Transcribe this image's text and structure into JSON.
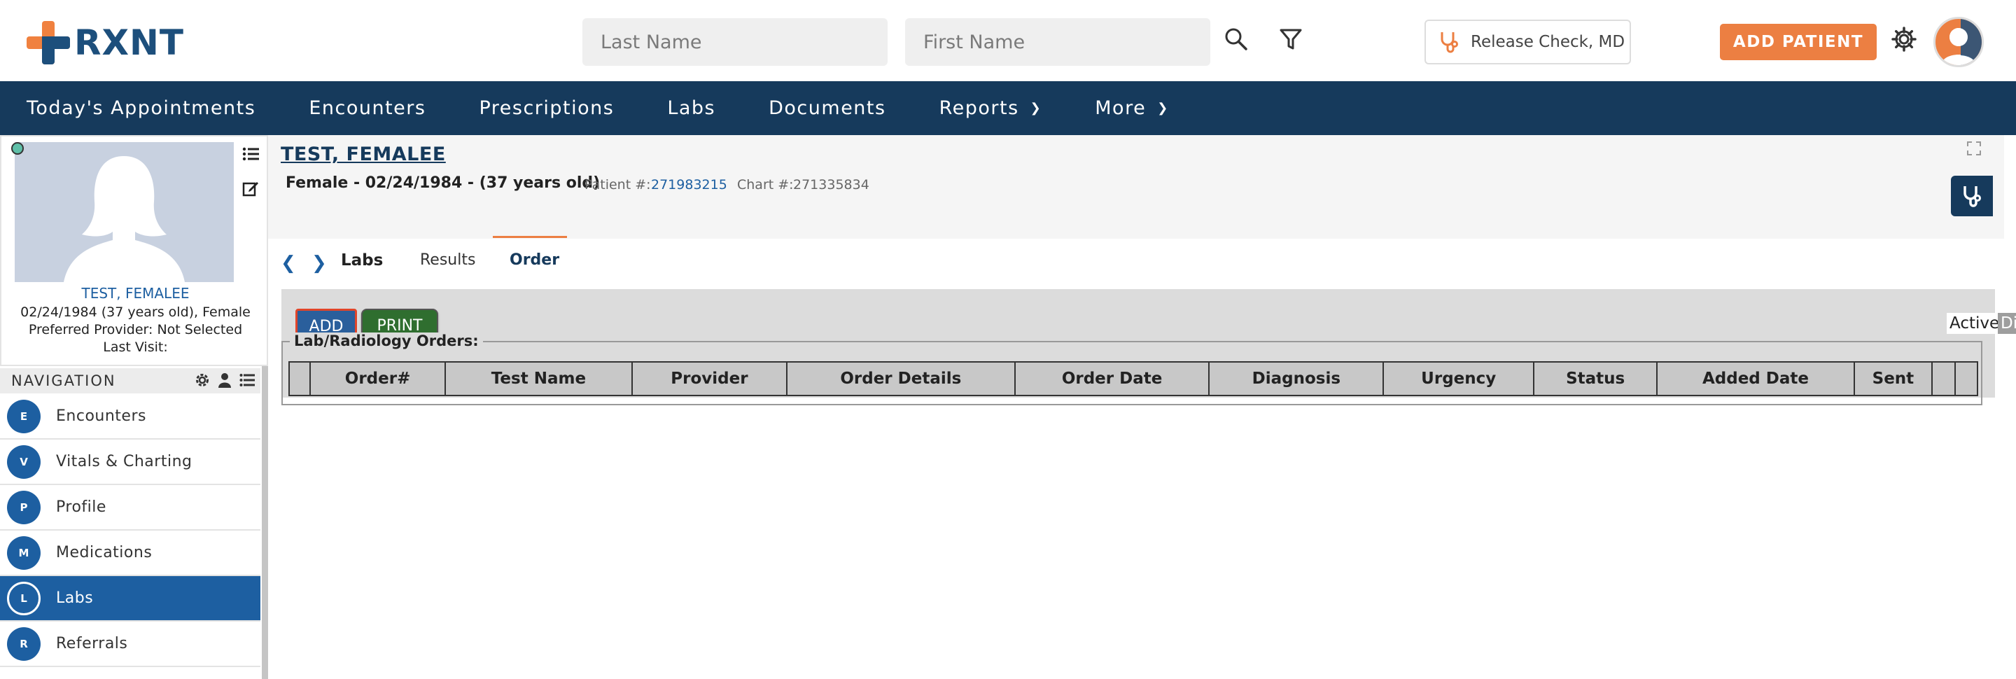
{
  "header": {
    "logo_text": "RXNT",
    "last_name_placeholder": "Last Name",
    "first_name_placeholder": "First Name",
    "release_check_label": "Release Check, MD",
    "add_patient_label": "ADD PATIENT",
    "accent_color": "#ec7f42",
    "brand_color": "#163a5c"
  },
  "navbar": {
    "items": [
      {
        "label": "Today's Appointments"
      },
      {
        "label": "Encounters"
      },
      {
        "label": "Prescriptions"
      },
      {
        "label": "Labs"
      },
      {
        "label": "Documents"
      },
      {
        "label": "Reports"
      },
      {
        "label": "More"
      }
    ]
  },
  "patient_card": {
    "name": "TEST, FEMALEE",
    "dob_line": "02/24/1984 (37 years old), Female",
    "provider_line": "Preferred Provider: Not Selected",
    "last_visit_line": "Last Visit:"
  },
  "side_nav": {
    "title": "NAVIGATION",
    "items": [
      {
        "letter": "E",
        "label": "Encounters"
      },
      {
        "letter": "V",
        "label": "Vitals & Charting"
      },
      {
        "letter": "P",
        "label": "Profile"
      },
      {
        "letter": "M",
        "label": "Medications"
      },
      {
        "letter": "L",
        "label": "Labs"
      },
      {
        "letter": "R",
        "label": "Referrals"
      }
    ]
  },
  "patient_header": {
    "name": "TEST, FEMALEE",
    "info": "Female - 02/24/1984 - (37 years old)",
    "patient_num_label": "Patient #:",
    "patient_num": "271983215",
    "chart_num_label": "Chart #:",
    "chart_num": "271335834"
  },
  "tabs": {
    "title": "Labs",
    "items": [
      {
        "label": "Results"
      },
      {
        "label": "Order"
      }
    ],
    "active": "Order"
  },
  "toolbar": {
    "add_label": "ADD",
    "print_label": "PRINT",
    "filter_active": "Active",
    "filter_discontinued": "Discontinued"
  },
  "orders": {
    "legend": "Lab/Radiology Orders:",
    "columns": [
      "",
      "Order#",
      "Test Name",
      "Provider",
      "Order Details",
      "Order Date",
      "Diagnosis",
      "Urgency",
      "Status",
      "Added Date",
      "Sent",
      "",
      ""
    ]
  }
}
